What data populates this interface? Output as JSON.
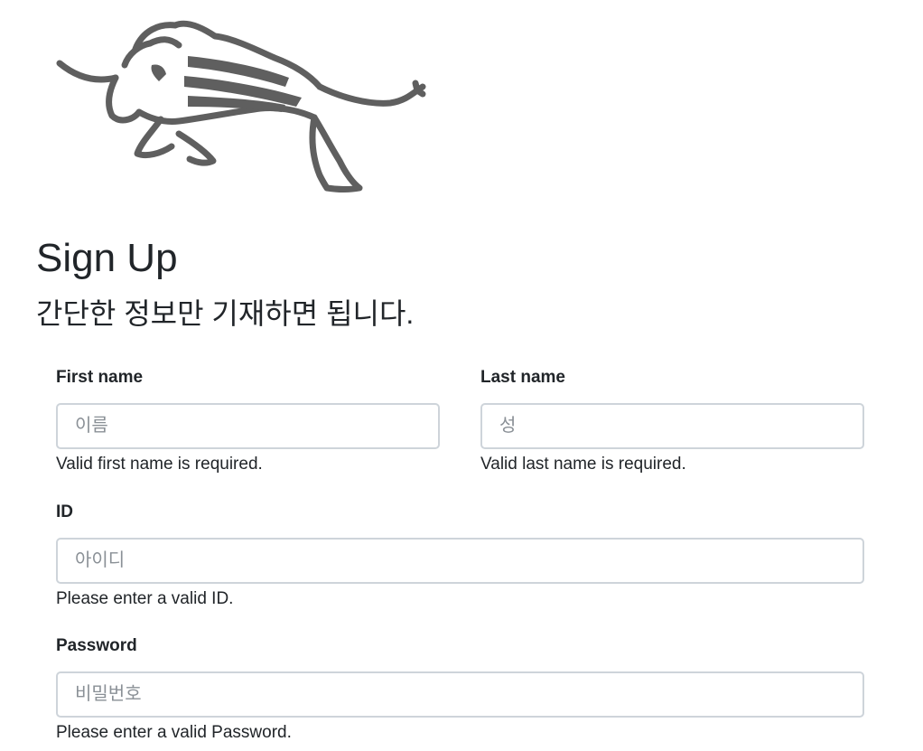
{
  "logo": {
    "icon": "bull-logo-icon",
    "color": "#5f5f5f"
  },
  "header": {
    "title": "Sign Up",
    "subtitle": "간단한 정보만 기재하면 됩니다."
  },
  "form": {
    "first_name": {
      "label": "First name",
      "placeholder": "이름",
      "value": "",
      "feedback": "Valid first name is required."
    },
    "last_name": {
      "label": "Last name",
      "placeholder": "성",
      "value": "",
      "feedback": "Valid last name is required."
    },
    "id": {
      "label": "ID",
      "placeholder": "아이디",
      "value": "",
      "feedback": "Please enter a valid ID."
    },
    "password": {
      "label": "Password",
      "placeholder": "비밀번호",
      "value": "",
      "feedback": "Please enter a valid Password."
    }
  }
}
